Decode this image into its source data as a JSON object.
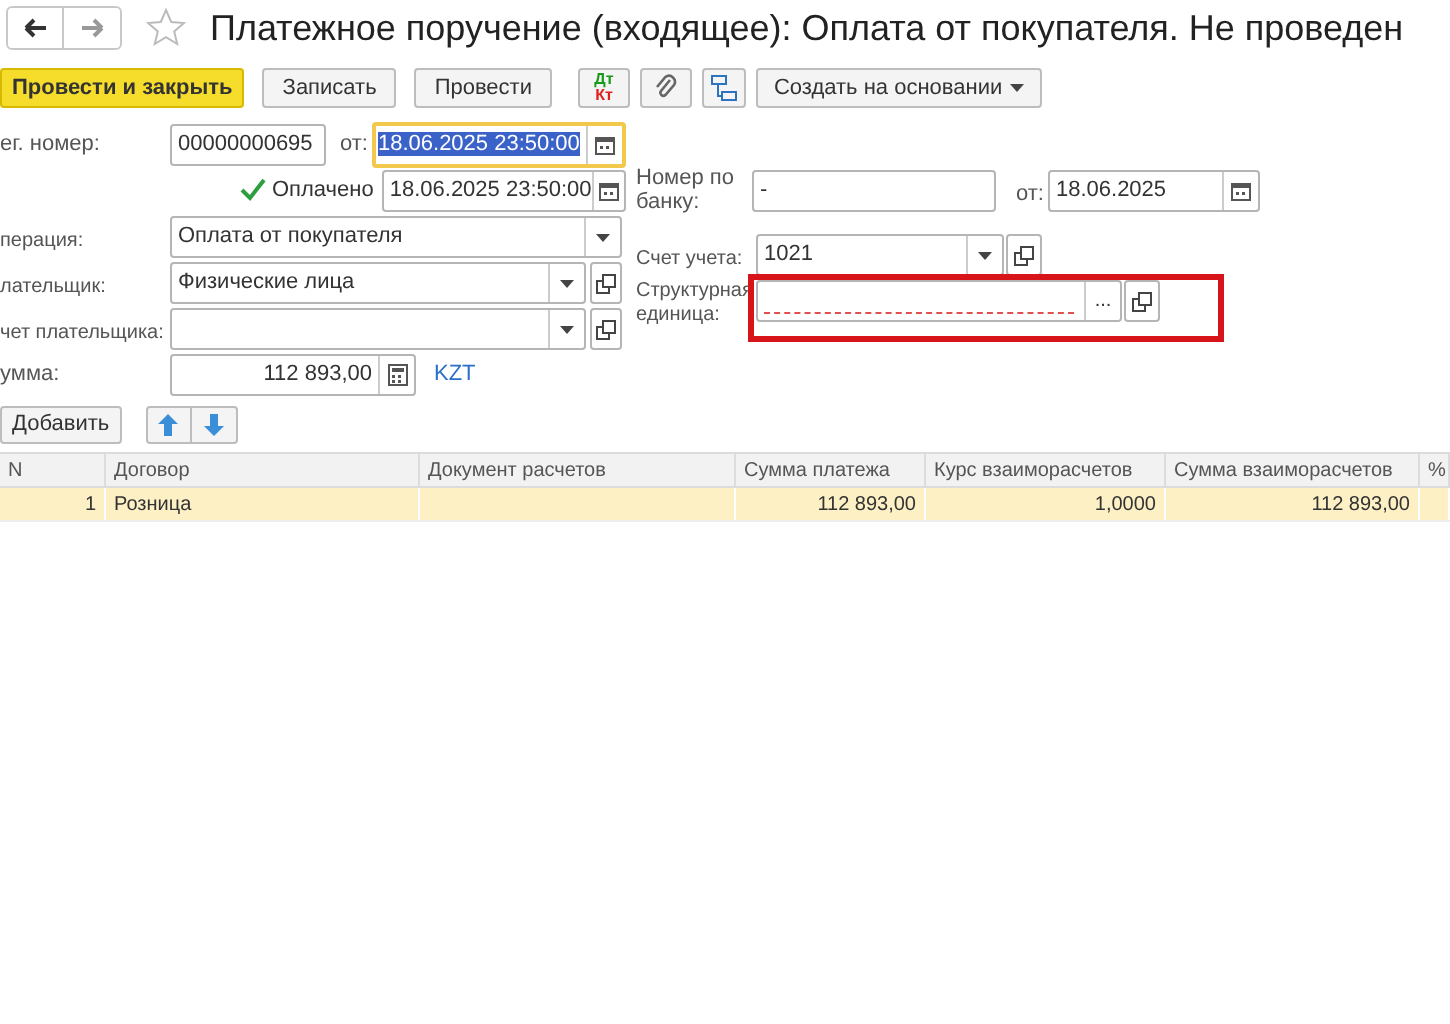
{
  "window": {
    "title": "Платежное поручение (входящее): Оплата от покупателя. Не проведен",
    "favorite": false
  },
  "toolbar": [
    {
      "label": "Провести и закрыть",
      "kind": "primary"
    },
    {
      "label": "Записать",
      "kind": "button"
    },
    {
      "label": "Провести",
      "kind": "button"
    },
    {
      "kind": "dtkt",
      "debit": "Дт",
      "credit": "Кт"
    },
    {
      "kind": "clip"
    },
    {
      "kind": "structure"
    },
    {
      "label": "Создать на основании",
      "kind": "menu"
    }
  ],
  "form": {
    "reg_number": {
      "label": "ег. номер:",
      "value": "00000000695"
    },
    "date": {
      "label": "от:",
      "value": "18.06.2025 23:50:00",
      "focused": true
    },
    "paid": {
      "label": "Оплачено",
      "checked": true,
      "value": "18.06.2025 23:50:00"
    },
    "bank_number": {
      "label": "Номер по банку:",
      "value": "-",
      "date_label": "от:",
      "date": "18.06.2025"
    },
    "operation": {
      "label": "перация:",
      "value": "Оплата от покупателя"
    },
    "account": {
      "label": "Счет учета:",
      "value": "1021"
    },
    "payer": {
      "label": "лательщик:",
      "value": "Физические лица"
    },
    "unit": {
      "label": "Структурная единица:",
      "select": "...",
      "required": true,
      "highlighted": true
    },
    "payer_account": {
      "label": "чет плательщика:"
    },
    "sum": {
      "label": "умма:",
      "value": "112 893,00",
      "currency": "KZT"
    }
  },
  "table_buttons": {
    "add": "Добавить"
  },
  "table": {
    "columns": [
      "N",
      "Договор",
      "Документ расчетов",
      "Сумма платежа",
      "Курс взаиморасчетов",
      "Сумма взаиморасчетов",
      "%"
    ],
    "rows": [
      {
        "selected": true,
        "cells": [
          "1",
          "Розница",
          "",
          "112 893,00",
          "1,0000",
          "112 893,00",
          ""
        ]
      }
    ]
  }
}
